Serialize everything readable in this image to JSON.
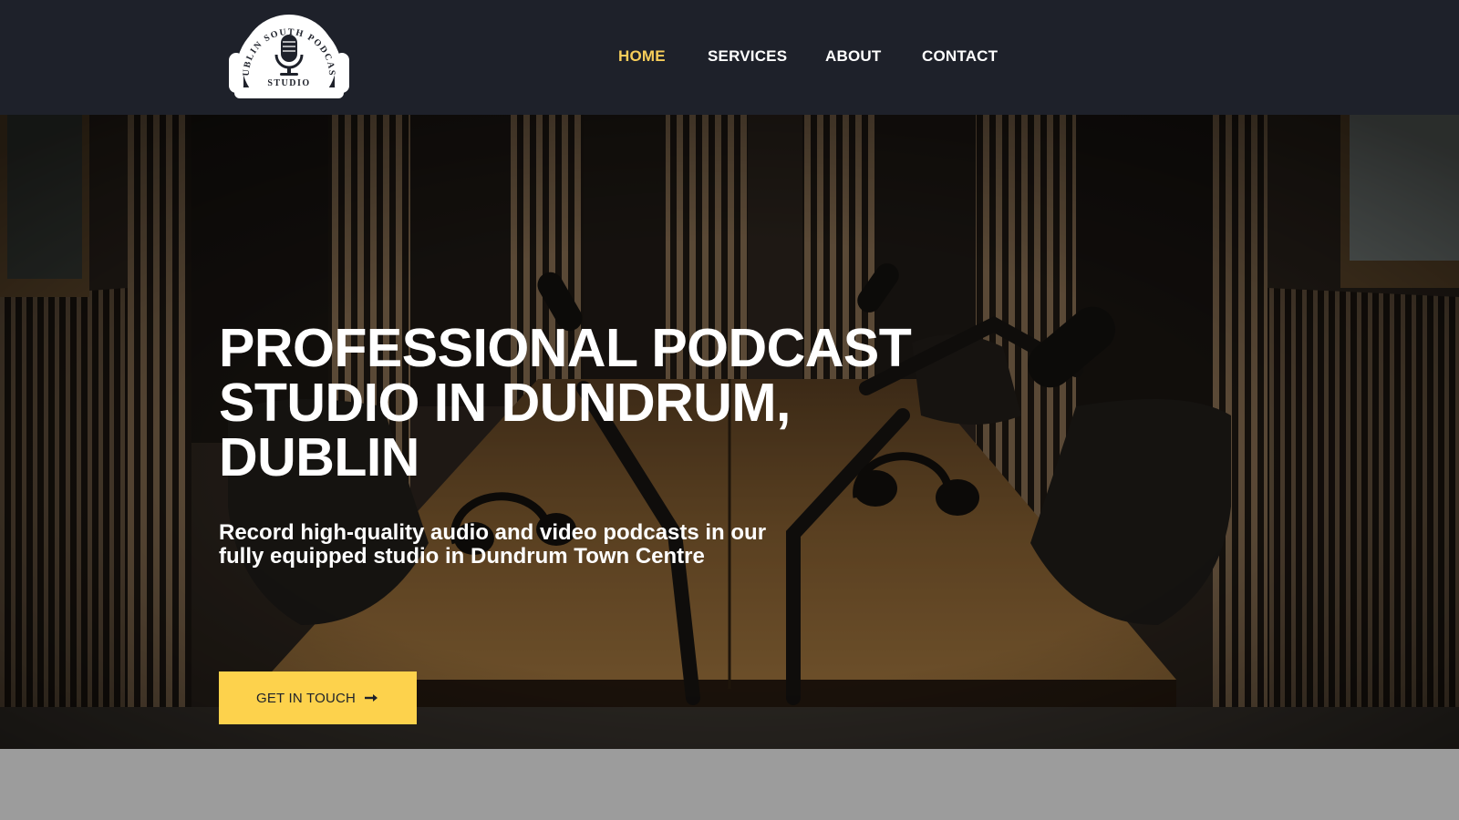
{
  "header": {
    "logo": {
      "arc_text": "DUBLIN SOUTH PODCAST",
      "bottom_text": "STUDIO",
      "icon": "microphone-icon"
    },
    "nav": [
      {
        "label": "HOME",
        "active": true
      },
      {
        "label": "SERVICES",
        "active": false
      },
      {
        "label": "ABOUT",
        "active": false
      },
      {
        "label": "CONTACT",
        "active": false
      }
    ]
  },
  "hero": {
    "title": "PROFESSIONAL PODCAST STUDIO IN DUNDRUM, DUBLIN",
    "subtitle": "Record high-quality audio and video podcasts in our fully equipped studio in Dundrum Town Centre",
    "cta": {
      "label": "GET IN TOUCH",
      "icon": "arrow-right-icon"
    },
    "background": "podcast-studio-photo"
  },
  "colors": {
    "header_bg": "#1e212a",
    "accent": "#fdd24c",
    "nav_active": "#f6cd5a",
    "footer_strip": "#9c9c9c"
  }
}
